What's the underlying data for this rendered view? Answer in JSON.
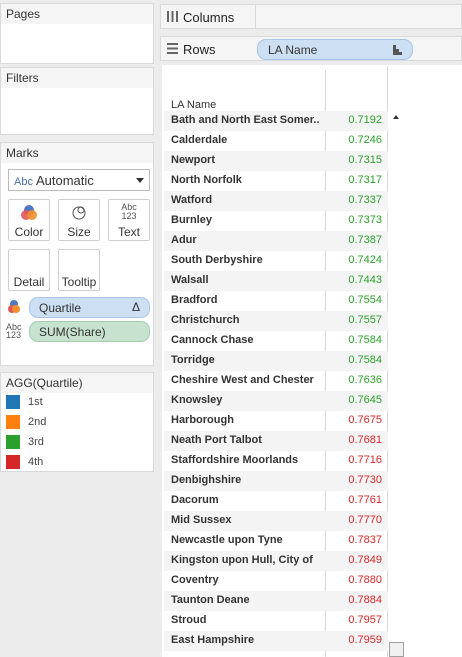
{
  "pages": {
    "title": "Pages"
  },
  "filters": {
    "title": "Filters"
  },
  "marks": {
    "title": "Marks",
    "type_abc": "Abc",
    "type_value": "Automatic",
    "buttons": [
      {
        "label": "Color",
        "icon": "color-icon"
      },
      {
        "label": "Size",
        "icon": "size-icon"
      },
      {
        "label": "Text",
        "icon": "text-icon",
        "icon_text": "Abc\n123"
      },
      {
        "label": "Detail",
        "icon": "detail-icon"
      },
      {
        "label": "Tooltip",
        "icon": "tooltip-icon"
      }
    ],
    "fields": [
      {
        "label": "Quartile",
        "suffix": "Δ",
        "icon": "color-field-icon"
      },
      {
        "label": "SUM(Share)",
        "icon": "text-field-icon",
        "icon_text": "Abc\n123"
      }
    ]
  },
  "legend": {
    "title": "AGG(Quartile)",
    "items": [
      {
        "label": "1st",
        "color": "#1f77b4"
      },
      {
        "label": "2nd",
        "color": "#ff7f0e"
      },
      {
        "label": "3rd",
        "color": "#2ca02c"
      },
      {
        "label": "4th",
        "color": "#d62728"
      }
    ]
  },
  "shelves": {
    "columns": {
      "label": "Columns"
    },
    "rows": {
      "label": "Rows",
      "pill": "LA Name"
    }
  },
  "table": {
    "header": "LA Name",
    "colors": {
      "green": "#2ca02c",
      "red": "#d62728"
    },
    "rows": [
      {
        "name": "Bath and North East Somer..",
        "value": "0.7192",
        "q": "green"
      },
      {
        "name": "Calderdale",
        "value": "0.7246",
        "q": "green"
      },
      {
        "name": "Newport",
        "value": "0.7315",
        "q": "green"
      },
      {
        "name": "North Norfolk",
        "value": "0.7317",
        "q": "green"
      },
      {
        "name": "Watford",
        "value": "0.7337",
        "q": "green"
      },
      {
        "name": "Burnley",
        "value": "0.7373",
        "q": "green"
      },
      {
        "name": "Adur",
        "value": "0.7387",
        "q": "green"
      },
      {
        "name": "South Derbyshire",
        "value": "0.7424",
        "q": "green"
      },
      {
        "name": "Walsall",
        "value": "0.7443",
        "q": "green"
      },
      {
        "name": "Bradford",
        "value": "0.7554",
        "q": "green"
      },
      {
        "name": "Christchurch",
        "value": "0.7557",
        "q": "green"
      },
      {
        "name": "Cannock Chase",
        "value": "0.7584",
        "q": "green"
      },
      {
        "name": "Torridge",
        "value": "0.7584",
        "q": "green"
      },
      {
        "name": "Cheshire West and Chester",
        "value": "0.7636",
        "q": "green"
      },
      {
        "name": "Knowsley",
        "value": "0.7645",
        "q": "green"
      },
      {
        "name": "Harborough",
        "value": "0.7675",
        "q": "red"
      },
      {
        "name": "Neath Port Talbot",
        "value": "0.7681",
        "q": "red"
      },
      {
        "name": "Staffordshire Moorlands",
        "value": "0.7716",
        "q": "red"
      },
      {
        "name": "Denbighshire",
        "value": "0.7730",
        "q": "red"
      },
      {
        "name": "Dacorum",
        "value": "0.7761",
        "q": "red"
      },
      {
        "name": "Mid Sussex",
        "value": "0.7770",
        "q": "red"
      },
      {
        "name": "Newcastle upon Tyne",
        "value": "0.7837",
        "q": "red"
      },
      {
        "name": "Kingston upon Hull, City of",
        "value": "0.7849",
        "q": "red"
      },
      {
        "name": "Coventry",
        "value": "0.7880",
        "q": "red"
      },
      {
        "name": "Taunton Deane",
        "value": "0.7884",
        "q": "red"
      },
      {
        "name": "Stroud",
        "value": "0.7957",
        "q": "red"
      },
      {
        "name": "East Hampshire",
        "value": "0.7959",
        "q": "red"
      }
    ]
  }
}
